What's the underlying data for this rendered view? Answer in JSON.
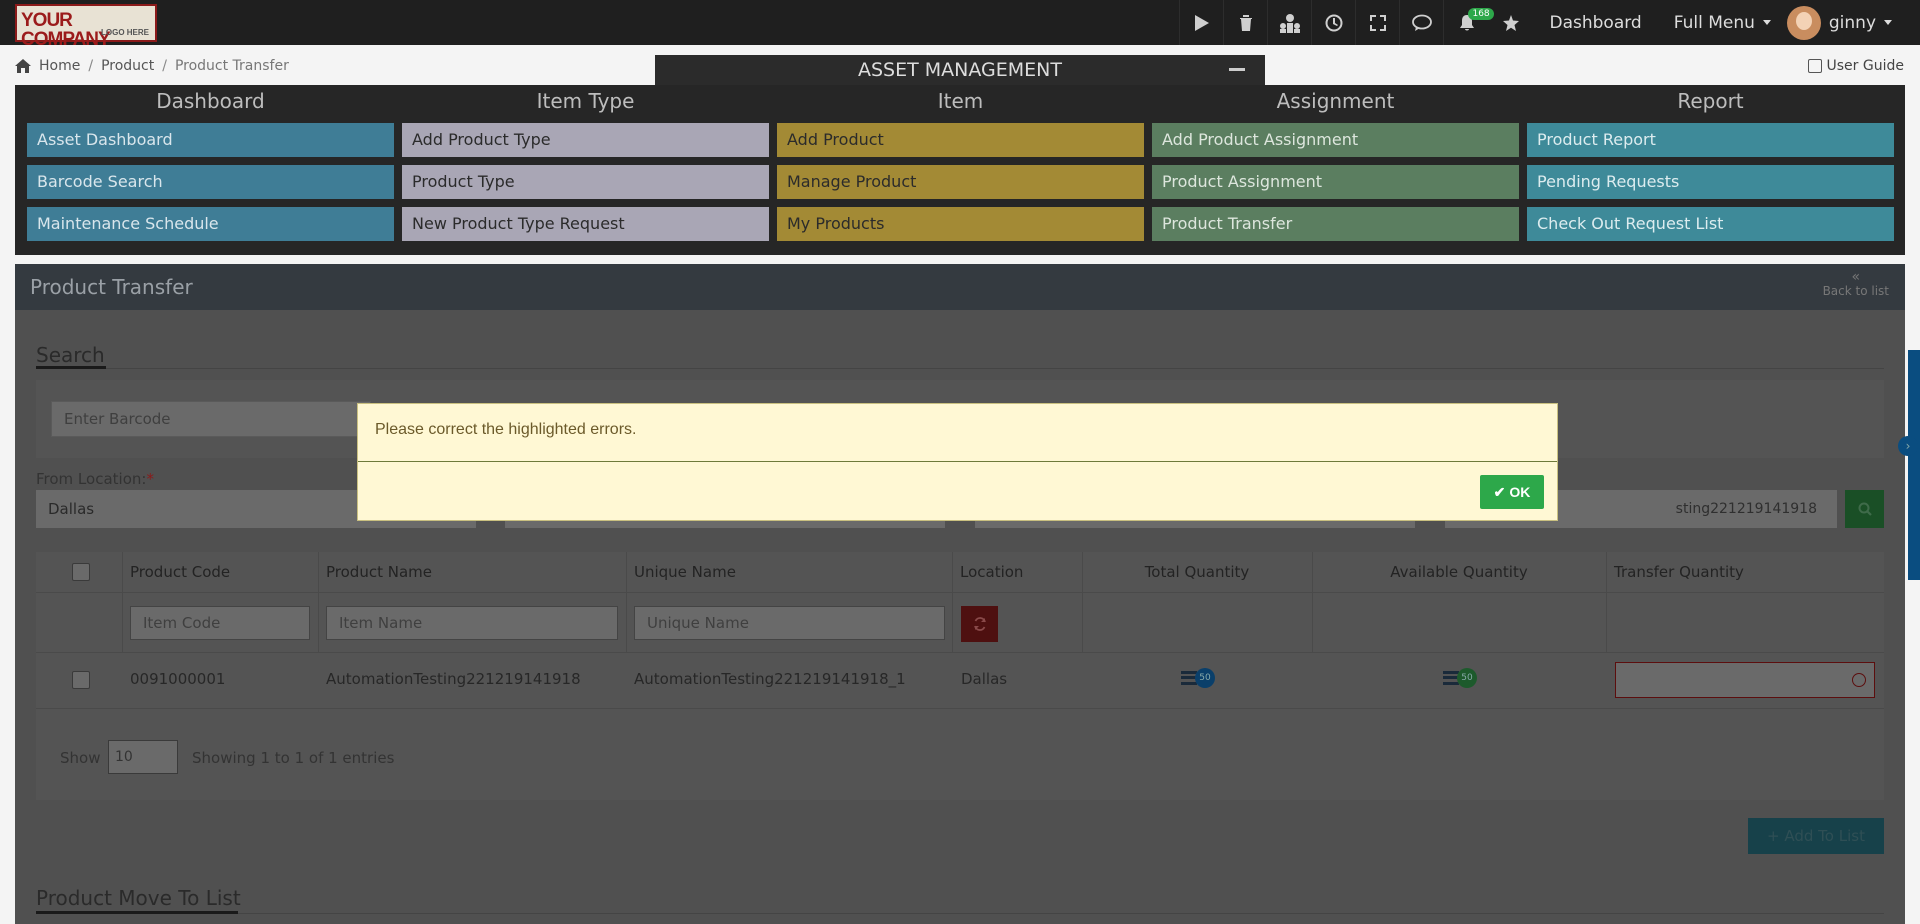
{
  "topbar": {
    "logo_line1": "YOUR COMPANY",
    "logo_line2": "LOGO HERE",
    "notification_count": "168",
    "dashboard_label": "Dashboard",
    "full_menu_label": "Full Menu",
    "user_name": "ginny"
  },
  "breadcrumb": {
    "home": "Home",
    "product": "Product",
    "current": "Product Transfer"
  },
  "user_guide_label": "User Guide",
  "asset_management": {
    "title": "ASSET MANAGEMENT",
    "columns": [
      {
        "head": "Dashboard",
        "items": [
          "Asset Dashboard",
          "Barcode Search",
          "Maintenance Schedule"
        ]
      },
      {
        "head": "Item Type",
        "items": [
          "Add Product Type",
          "Product Type",
          "New Product Type Request"
        ]
      },
      {
        "head": "Item",
        "items": [
          "Add Product",
          "Manage Product",
          "My Products"
        ]
      },
      {
        "head": "Assignment",
        "items": [
          "Add Product Assignment",
          "Product Assignment",
          "Product Transfer"
        ]
      },
      {
        "head": "Report",
        "items": [
          "Product Report",
          "Pending Requests",
          "Check Out Request List"
        ]
      }
    ]
  },
  "page": {
    "title": "Product Transfer",
    "back_label": "Back to list"
  },
  "search": {
    "title": "Search",
    "barcode_placeholder": "Enter Barcode",
    "from_location_label": "From Location:",
    "from_location_required": "*",
    "from_location_value": "Dallas",
    "product_search_value": "sting221219141918"
  },
  "table": {
    "headers": [
      "Product Code",
      "Product Name",
      "Unique Name",
      "Location",
      "Total Quantity",
      "Available Quantity",
      "Transfer Quantity"
    ],
    "filter_placeholders": {
      "code": "Item Code",
      "name": "Item Name",
      "unique": "Unique Name"
    },
    "rows": [
      {
        "code": "0091000001",
        "name": "AutomationTesting221219141918",
        "unique": "AutomationTesting221219141918_1",
        "location": "Dallas",
        "total": "50",
        "available": "50",
        "transfer": ""
      }
    ],
    "show_label": "Show",
    "page_length": "10",
    "info": "Showing 1 to 1 of 1 entries"
  },
  "add_to_list_label": "Add To List",
  "move_list_title": "Product Move To List",
  "modal": {
    "message": "Please correct the highlighted errors.",
    "ok_label": "OK"
  },
  "colors": {
    "ok_button": "#2da84a",
    "modal_bg": "#fff8d4",
    "topbar": "#1f1f1f"
  }
}
